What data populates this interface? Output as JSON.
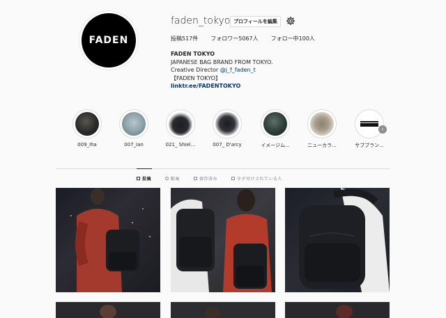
{
  "profile": {
    "username": "faden_tokyo",
    "avatar_text": "FADEN",
    "edit_button": "プロフィールを編集",
    "stats": {
      "posts": "投稿517件",
      "followers": "フォロワー5067人",
      "following": "フォロー中100人"
    },
    "bio": {
      "name": "FADEN TOKYO",
      "line1": "JAPANESE BAG BRAND FROM TOKYO.",
      "line2_prefix": "Creative Director ",
      "mention": "@j_f_faden_t",
      "line3": "【FADEN TOKYO】",
      "link": "linktr.ee/FADENTOKYO"
    }
  },
  "highlights": [
    {
      "label": "009_Iha"
    },
    {
      "label": "007_Ian"
    },
    {
      "label": "021_ Shiel..."
    },
    {
      "label": "007_ D'arcy"
    },
    {
      "label": "イメージム..."
    },
    {
      "label": "ニューカラ..."
    },
    {
      "label": "サブブラン..."
    }
  ],
  "tabs": {
    "posts": "投稿",
    "videos": "動画",
    "saved": "保存済み",
    "tagged": "タグ付けされている人"
  },
  "icons": {
    "settings": "gear-icon",
    "next": "chevron-right-icon"
  },
  "colors": {
    "link": "#00376b",
    "avatar_bg": "#000000"
  }
}
